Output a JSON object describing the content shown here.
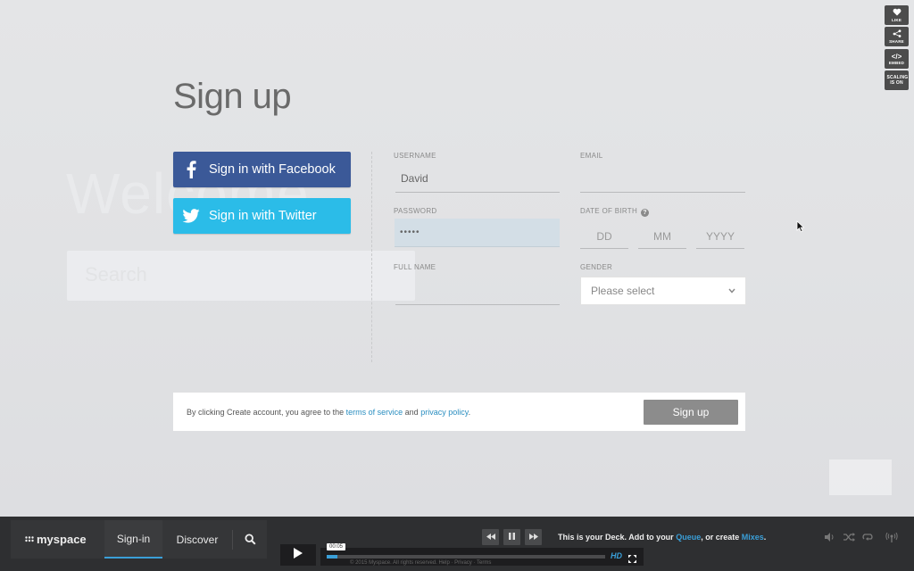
{
  "background": {
    "welcome_text": "Welcome",
    "search_placeholder": "Search"
  },
  "widgets": [
    {
      "name": "like",
      "label": "LIKE",
      "icon": "heart-icon"
    },
    {
      "name": "share",
      "label": "SHARE",
      "icon": "share-icon"
    },
    {
      "name": "embed",
      "label": "EMBED",
      "icon": "code-icon"
    },
    {
      "name": "scaling",
      "label": "SCALING IS ON",
      "icon": ""
    }
  ],
  "signup": {
    "title": "Sign up",
    "facebook_label": "Sign in with Facebook",
    "twitter_label": "Sign in with Twitter",
    "colors": {
      "facebook": "#3b5998",
      "twitter": "#2bbce8",
      "link": "#2a8ec0"
    },
    "fields": {
      "username_label": "USERNAME",
      "username_value": "David",
      "email_label": "EMAIL",
      "email_value": "",
      "password_label": "PASSWORD",
      "password_value": "•••••",
      "dob_label": "DATE OF BIRTH",
      "dob_day": "DD",
      "dob_month": "MM",
      "dob_year": "YYYY",
      "fullname_label": "FULL NAME",
      "fullname_value": "",
      "gender_label": "GENDER",
      "gender_value": "Please select"
    },
    "agreement": {
      "prefix": "By clicking Create account, you agree to the",
      "terms": "terms of service",
      "and": "and",
      "privacy": "privacy policy",
      "suffix": "."
    },
    "submit_label": "Sign up"
  },
  "bottom_bar": {
    "logo": "myspace",
    "nav": [
      "Sign-in",
      "Discover"
    ],
    "deck_message": {
      "prefix": "This is your Deck. Add to your",
      "queue": "Queue",
      "middle": ", or create",
      "mixes": "Mixes",
      "suffix": "."
    },
    "player": {
      "time": "00:05",
      "progress": 0.04,
      "hd_label": "HD"
    },
    "copyright": "© 2015 Myspace. All rights reserved.  Help · Privacy · Terms"
  }
}
